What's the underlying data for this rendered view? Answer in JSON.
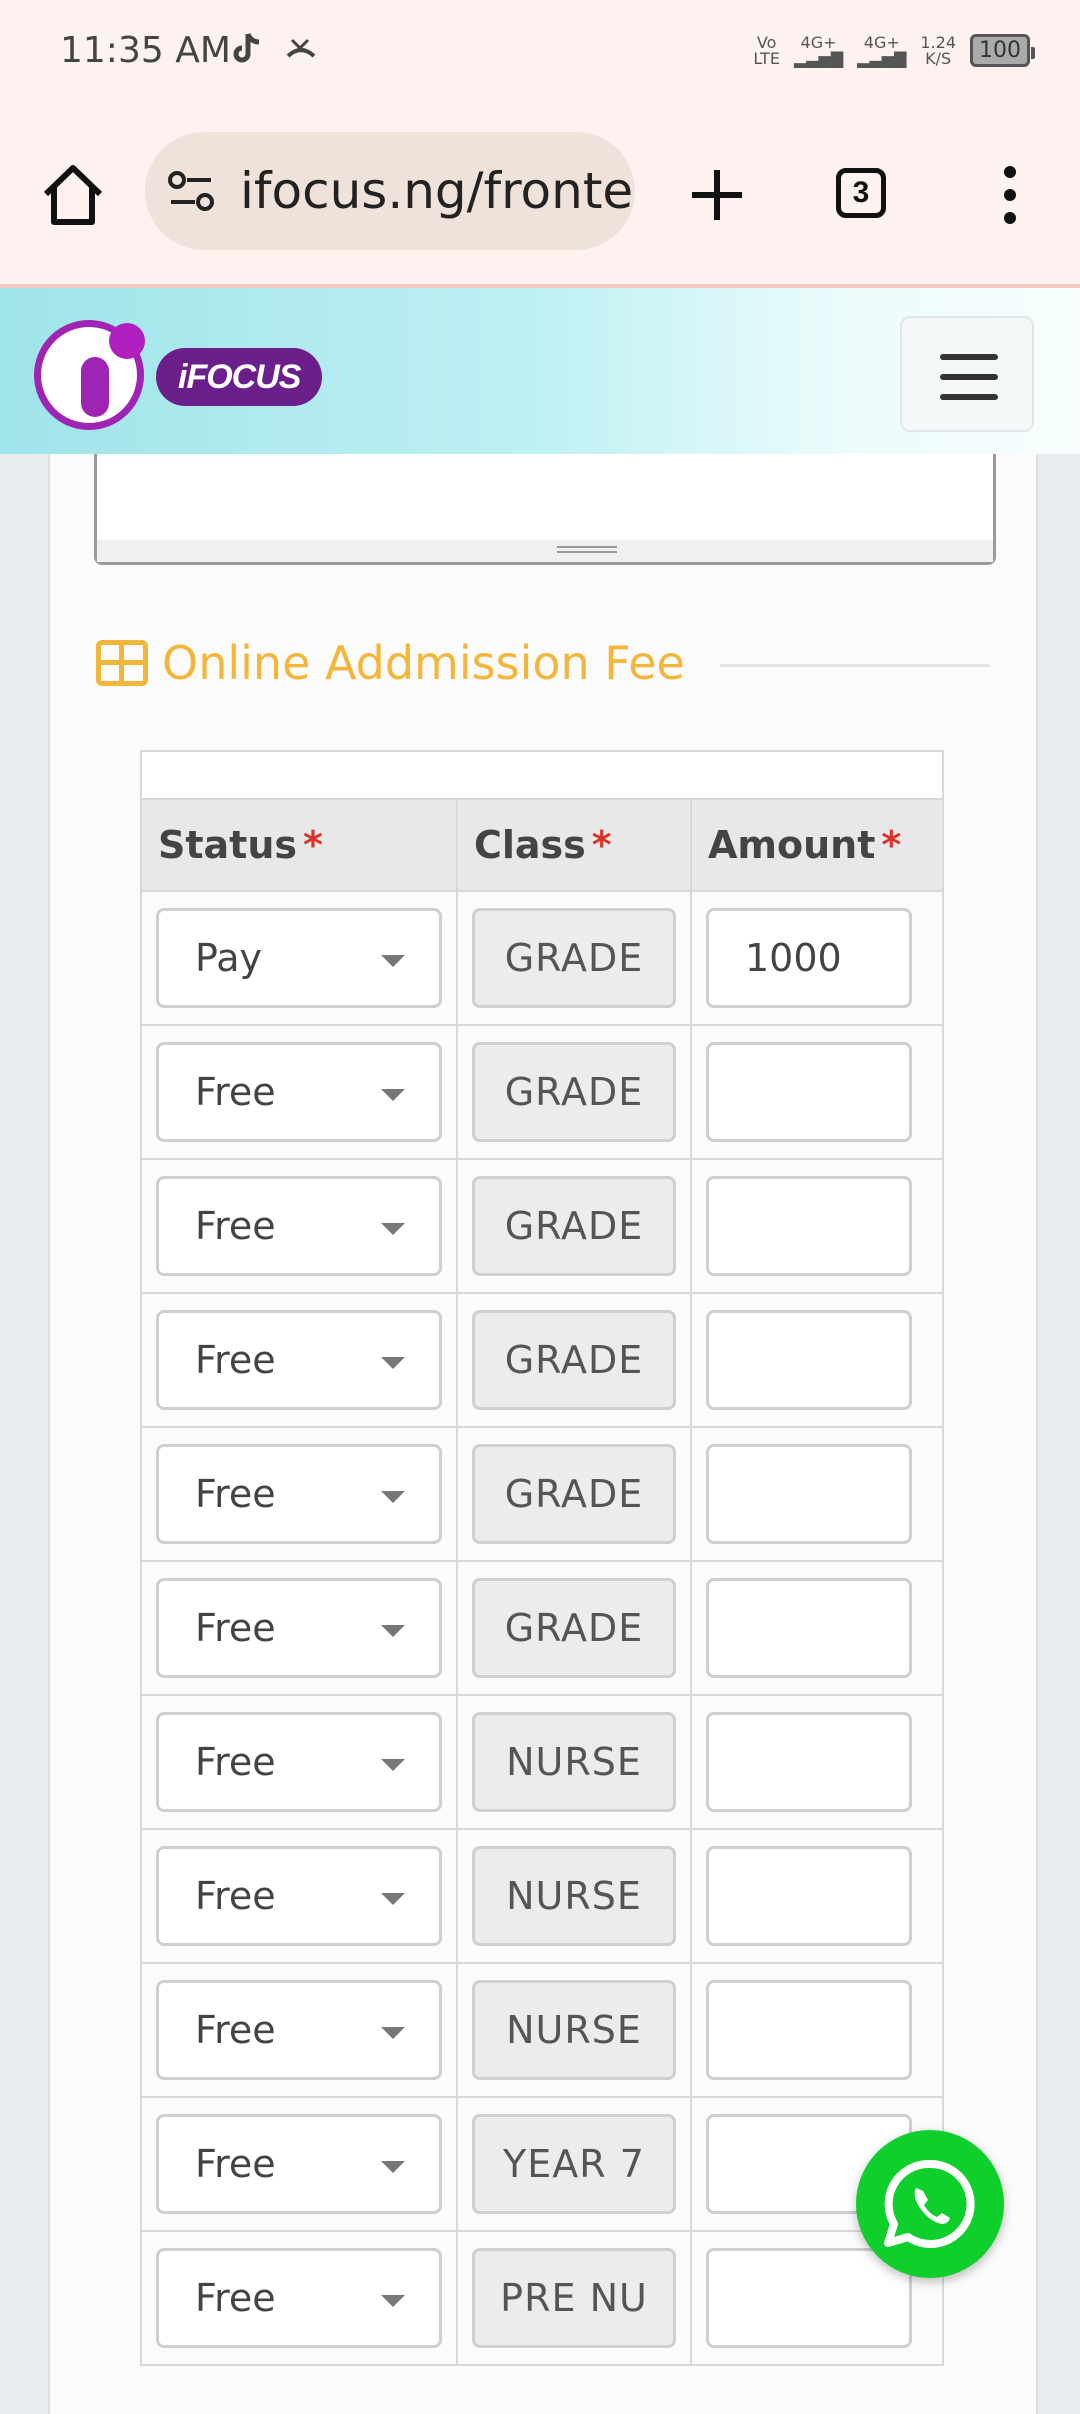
{
  "statusbar": {
    "time": "11:35 AM",
    "volte": "Vo\nLTE",
    "network1": "4G+",
    "network2": "4G+",
    "speed": "1.24\nK/S",
    "battery": "100"
  },
  "browser": {
    "url": "ifocus.ng/frontend",
    "tab_count": "3"
  },
  "site": {
    "logo_text": "iFOCUS"
  },
  "section": {
    "title": "Online Addmission Fee",
    "accent_color": "#f4b63a"
  },
  "table": {
    "headers": [
      {
        "label": "Status",
        "required": "*"
      },
      {
        "label": "Class",
        "required": "*"
      },
      {
        "label": "Amount",
        "required": "*"
      }
    ],
    "rows": [
      {
        "status": "Pay",
        "class": "GRADE",
        "amount": "1000"
      },
      {
        "status": "Free",
        "class": "GRADE",
        "amount": ""
      },
      {
        "status": "Free",
        "class": "GRADE",
        "amount": ""
      },
      {
        "status": "Free",
        "class": "GRADE",
        "amount": ""
      },
      {
        "status": "Free",
        "class": "GRADE",
        "amount": ""
      },
      {
        "status": "Free",
        "class": "GRADE",
        "amount": ""
      },
      {
        "status": "Free",
        "class": "NURSE",
        "amount": ""
      },
      {
        "status": "Free",
        "class": "NURSE",
        "amount": ""
      },
      {
        "status": "Free",
        "class": "NURSE",
        "amount": ""
      },
      {
        "status": "Free",
        "class": "YEAR 7",
        "amount": ""
      },
      {
        "status": "Free",
        "class": "PRE NU",
        "amount": ""
      }
    ]
  },
  "icons": {
    "home": "home-icon",
    "site_info": "site-settings-icon",
    "new_tab": "plus-icon",
    "tabs": "tab-switcher-icon",
    "menu": "more-vert-icon",
    "hamburger": "menu-icon",
    "whatsapp": "whatsapp-icon"
  },
  "colors": {
    "whatsapp": "#0fcf2c",
    "required": "#d9342b",
    "brand": "#a024b3"
  }
}
